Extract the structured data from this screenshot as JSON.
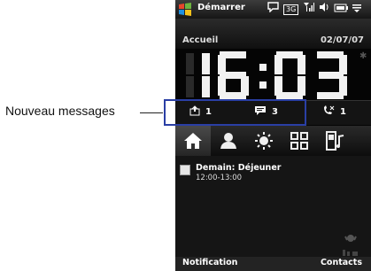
{
  "annotation": {
    "label": "Nouveau messages"
  },
  "titlebar": {
    "start_label": "Démarrer",
    "icons": [
      "chat-bubble-icon",
      "3g-icon",
      "signal-icon",
      "speaker-icon",
      "battery-icon",
      "menu-icon"
    ],
    "threeg_text": "3G"
  },
  "home": {
    "title": "Accueil",
    "date": "02/07/07",
    "time": "16:03"
  },
  "counters": {
    "voicemail": "1",
    "messages": "3",
    "missed_calls": "1"
  },
  "tabs": [
    "home-tab",
    "contacts-tab",
    "weather-tab",
    "programs-tab",
    "media-tab"
  ],
  "appointment": {
    "title": "Demain: Déjeuner",
    "time": "12:00-13:00"
  },
  "softkeys": {
    "left": "Notification",
    "right": "Contacts"
  },
  "colors": {
    "highlight": "#2a3fa5",
    "background": "#050505",
    "text": "#ffffff"
  }
}
